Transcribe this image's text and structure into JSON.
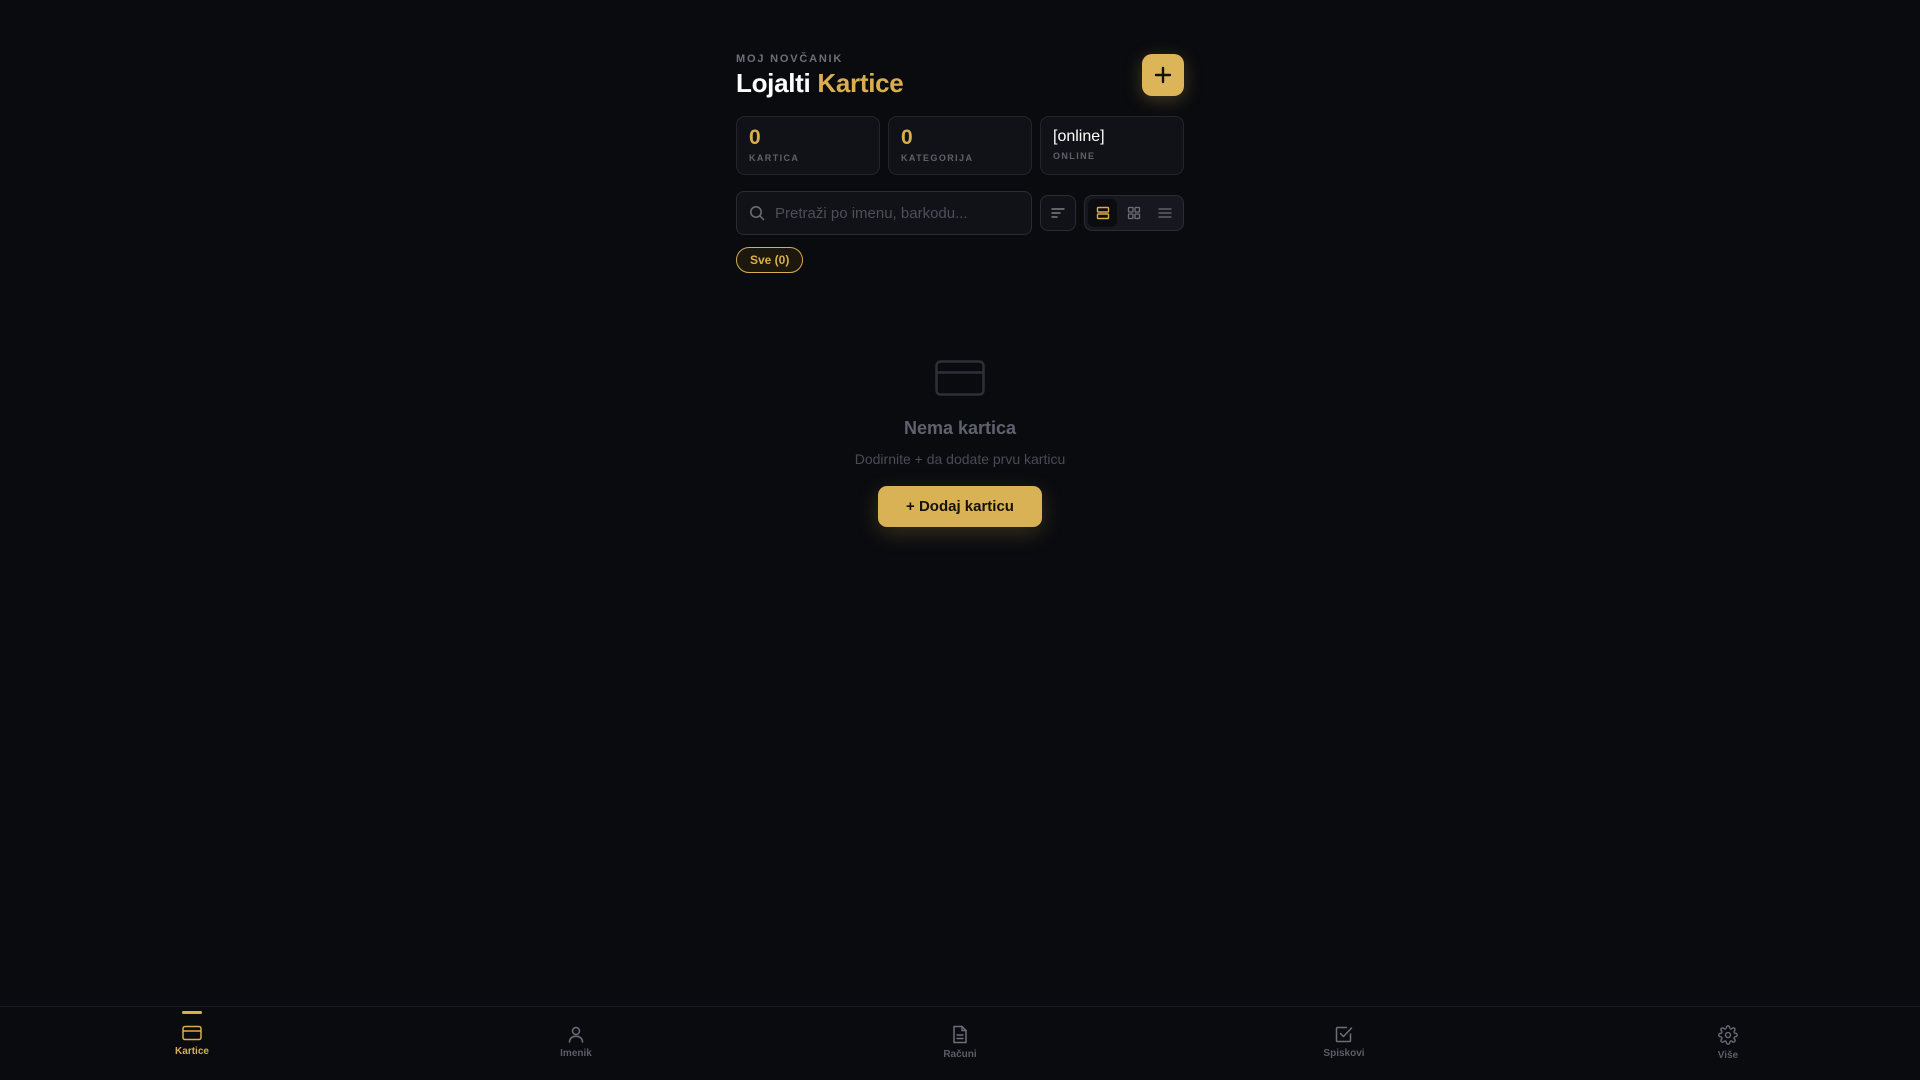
{
  "header": {
    "eyebrow": "MOJ NOVČANIK",
    "title_main": "Lojalti",
    "title_accent": "Kartice"
  },
  "stats": [
    {
      "value": "0",
      "label": "KARTICA"
    },
    {
      "value": "0",
      "label": "KATEGORIJA"
    },
    {
      "value": "[online]",
      "label": "ONLINE"
    }
  ],
  "search": {
    "placeholder": "Pretraži po imenu, barkodu...",
    "value": ""
  },
  "view_modes": [
    "list-cards",
    "grid",
    "compact-list"
  ],
  "filters": [
    {
      "label": "Sve (0)",
      "active": true
    }
  ],
  "empty_state": {
    "icon": "card-icon",
    "title": "Nema kartica",
    "subtitle": "Dodirnite + da dodate prvu karticu",
    "button_label": "+ Dodaj karticu"
  },
  "bottom_nav": [
    {
      "label": "Kartice",
      "icon": "card-icon",
      "active": true
    },
    {
      "label": "Imenik",
      "icon": "user-icon",
      "active": false
    },
    {
      "label": "Računi",
      "icon": "document-icon",
      "active": false
    },
    {
      "label": "Spiskovi",
      "icon": "checkbox-icon",
      "active": false
    },
    {
      "label": "Više",
      "icon": "gear-icon",
      "active": false
    }
  ],
  "colors": {
    "accent": "#d8ae4f",
    "background": "#0a0b0f",
    "surface": "#111218"
  }
}
